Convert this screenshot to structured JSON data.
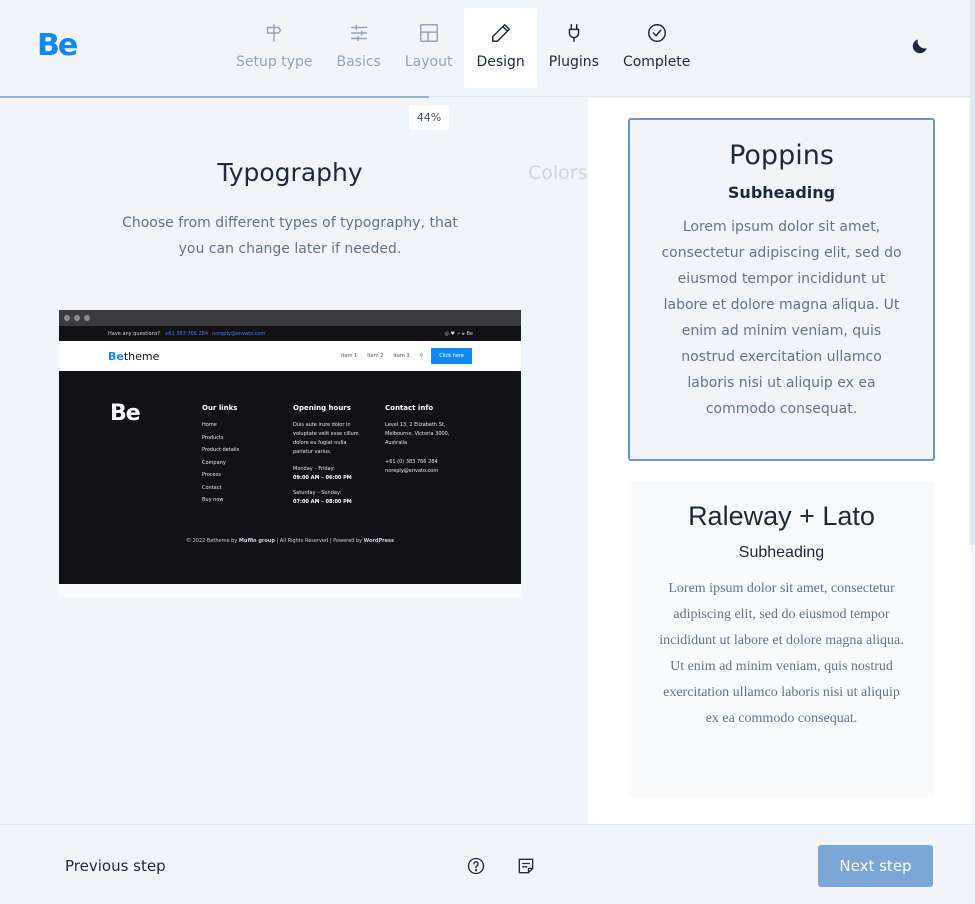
{
  "header": {
    "logo": "Be",
    "steps": [
      {
        "label": "Setup type",
        "icon": "signpost-icon",
        "state": "upcoming"
      },
      {
        "label": "Basics",
        "icon": "sliders-icon",
        "state": "upcoming"
      },
      {
        "label": "Layout",
        "icon": "layout-icon",
        "state": "upcoming"
      },
      {
        "label": "Design",
        "icon": "pencil-icon",
        "state": "active"
      },
      {
        "label": "Plugins",
        "icon": "plug-icon",
        "state": "upcoming"
      },
      {
        "label": "Complete",
        "icon": "check-circle-icon",
        "state": "upcoming"
      }
    ],
    "theme_toggle_icon": "moon-icon"
  },
  "progress": {
    "value": 0.44,
    "label": "44%"
  },
  "left": {
    "title": "Typography",
    "next_title": "Colors",
    "description": "Choose from different types of typography, that you can change later if needed."
  },
  "preview": {
    "info_text": "Have any questions?",
    "phone": "+61 383 766 284",
    "email": "noreply@envato.com",
    "logo_prefix": "Be",
    "logo_suffix": "theme",
    "nav_items": [
      "Item 1",
      "Item 2",
      "Item 3"
    ],
    "cta": "Click here",
    "footer_logo": "Be",
    "links_title": "Our links",
    "links": [
      "Home",
      "Products",
      "Product details",
      "Company",
      "Process",
      "Contact",
      "Buy now"
    ],
    "hours_title": "Opening hours",
    "hours_text": "Duis aute irure dolor in voluptate velit esse cillum dolore eu fugiat nulla pariatur varius.",
    "hours_weekday_label": "Monday – Friday:",
    "hours_weekday": "09:00 AM – 06:00 PM",
    "hours_weekend_label": "Saturday – Sunday:",
    "hours_weekend": "07:00 AM – 08:00 PM",
    "contact_title": "Contact info",
    "contact_address": "Level 13, 2 Elizabeth St, Melbourne, Victoria 3000, Australia",
    "contact_phone": "+61 (0) 383 766 284",
    "contact_email": "noreply@envato.com",
    "copyright_prefix": "© 2022 Betheme by",
    "copyright_brand": "Muffin group",
    "copyright_mid": "| All Rights Reserved | Powered by",
    "copyright_wp": "WordPress"
  },
  "fonts": [
    {
      "name": "Poppins",
      "subheading": "Subheading",
      "body": "Lorem ipsum dolor sit amet, consectetur adipiscing elit, sed do eiusmod tempor incididunt ut labore et dolore magna aliqua. Ut enim ad minim veniam, quis nostrud exercitation ullamco laboris nisi ut aliquip ex ea commodo consequat.",
      "selected": true
    },
    {
      "name": "Raleway + Lato",
      "subheading": "Subheading",
      "body": "Lorem ipsum dolor sit amet, consectetur adipiscing elit, sed do eiusmod tempor incididunt ut labore et dolore magna aliqua. Ut enim ad minim veniam, quis nostrud exercitation ullamco laboris nisi ut aliquip ex ea commodo consequat.",
      "selected": false
    }
  ],
  "footer": {
    "previous": "Previous step",
    "next": "Next step",
    "help_icon": "help-circle-icon",
    "notes_icon": "notes-icon"
  },
  "colors": {
    "brand": "#0e8af2",
    "accent_button": "#7aa6d8",
    "selected_border": "#6c96c8"
  }
}
